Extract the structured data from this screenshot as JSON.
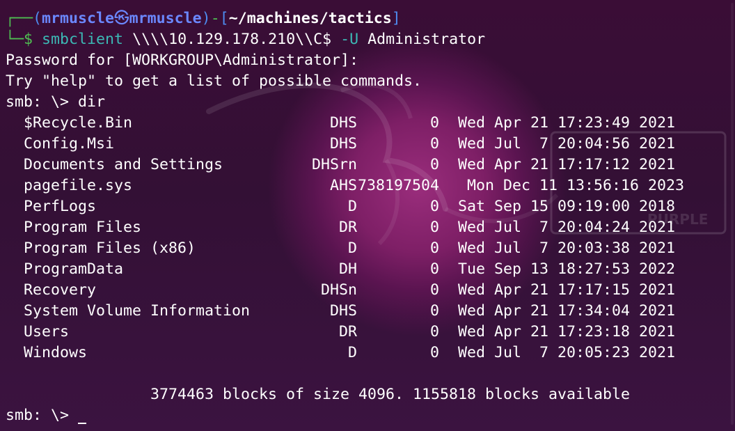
{
  "prompt": {
    "corner_top": "┌──",
    "user": "mrmuscle",
    "at_symbol": "㉿",
    "host": "mrmuscle",
    "dash": "-",
    "path": "~/machines/tactics",
    "corner_bottom": "└─",
    "dollar": "$"
  },
  "command": {
    "name": "smbclient",
    "target": "\\\\\\\\10.129.178.210\\\\C$",
    "flag": "-U",
    "user": "Administrator"
  },
  "output_lines": [
    "Password for [WORKGROUP\\Administrator]:",
    "Try \"help\" to get a list of possible commands."
  ],
  "smb_prompt": "smb: \\>",
  "smb_command": "dir",
  "listing": [
    {
      "name": "$Recycle.Bin",
      "attr": "DHS",
      "size": "0",
      "date": "Wed Apr 21 17:23:49 2021"
    },
    {
      "name": "Config.Msi",
      "attr": "DHS",
      "size": "0",
      "date": "Wed Jul  7 20:04:56 2021"
    },
    {
      "name": "Documents and Settings",
      "attr": "DHSrn",
      "size": "0",
      "date": "Wed Apr 21 17:17:12 2021"
    },
    {
      "name": "pagefile.sys",
      "attr": "AHS",
      "size": "738197504",
      "date": " Mon Dec 11 13:56:16 2023"
    },
    {
      "name": "PerfLogs",
      "attr": "D",
      "size": "0",
      "date": "Sat Sep 15 09:19:00 2018"
    },
    {
      "name": "Program Files",
      "attr": "DR",
      "size": "0",
      "date": "Wed Jul  7 20:04:24 2021"
    },
    {
      "name": "Program Files (x86)",
      "attr": "D",
      "size": "0",
      "date": "Wed Jul  7 20:03:38 2021"
    },
    {
      "name": "ProgramData",
      "attr": "DH",
      "size": "0",
      "date": "Tue Sep 13 18:27:53 2022"
    },
    {
      "name": "Recovery",
      "attr": "DHSn",
      "size": "0",
      "date": "Wed Apr 21 17:17:15 2021"
    },
    {
      "name": "System Volume Information",
      "attr": "DHS",
      "size": "0",
      "date": "Wed Apr 21 17:34:04 2021"
    },
    {
      "name": "Users",
      "attr": "DR",
      "size": "0",
      "date": "Wed Apr 21 17:23:18 2021"
    },
    {
      "name": "Windows",
      "attr": "D",
      "size": "0",
      "date": "Wed Jul  7 20:05:23 2021"
    }
  ],
  "summary": "3774463 blocks of size 4096. 1155818 blocks available",
  "final_prompt": "smb: \\> ",
  "wallpaper": {
    "logo_text": "PURPLE",
    "accent": "#7e1f66",
    "background": "#2d0a2b"
  }
}
